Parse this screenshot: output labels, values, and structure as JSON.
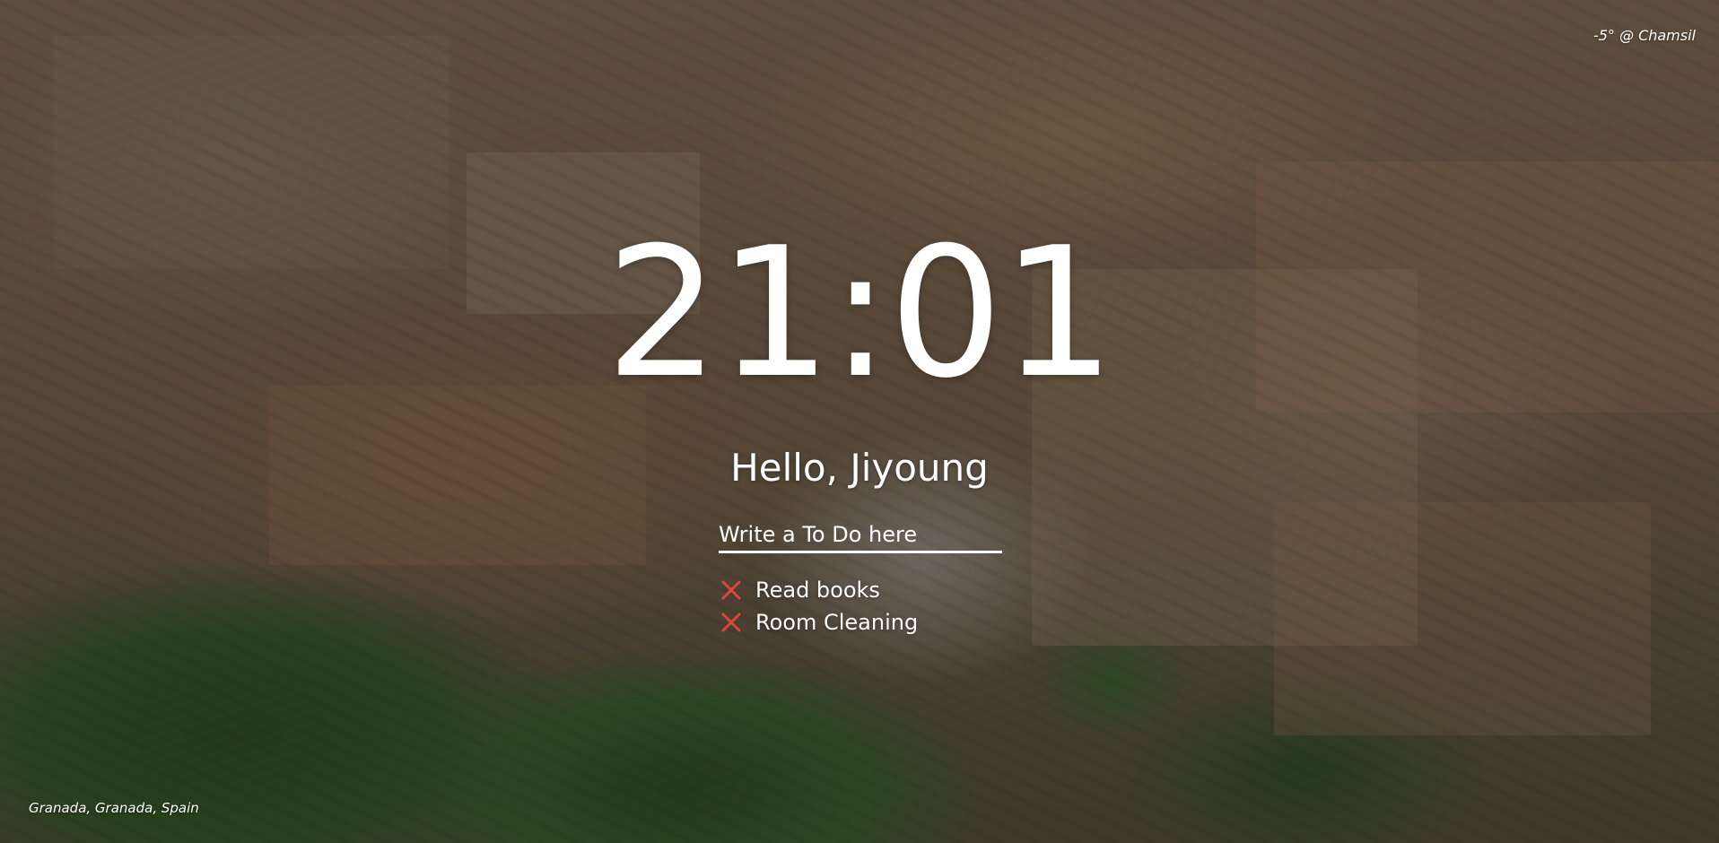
{
  "weather": {
    "text": "-5° @ Chamsil"
  },
  "clock": {
    "time": "21:01"
  },
  "greeting": {
    "text": "Hello, Jiyoung"
  },
  "todo": {
    "placeholder": "Write a To Do here",
    "items": [
      {
        "label": "Read books",
        "icon": "x-icon"
      },
      {
        "label": "Room Cleaning",
        "icon": "x-icon"
      }
    ]
  },
  "background": {
    "location": "Granada, Granada, Spain"
  },
  "colors": {
    "text": "#ffffff",
    "delete_icon": "#e0443a"
  }
}
